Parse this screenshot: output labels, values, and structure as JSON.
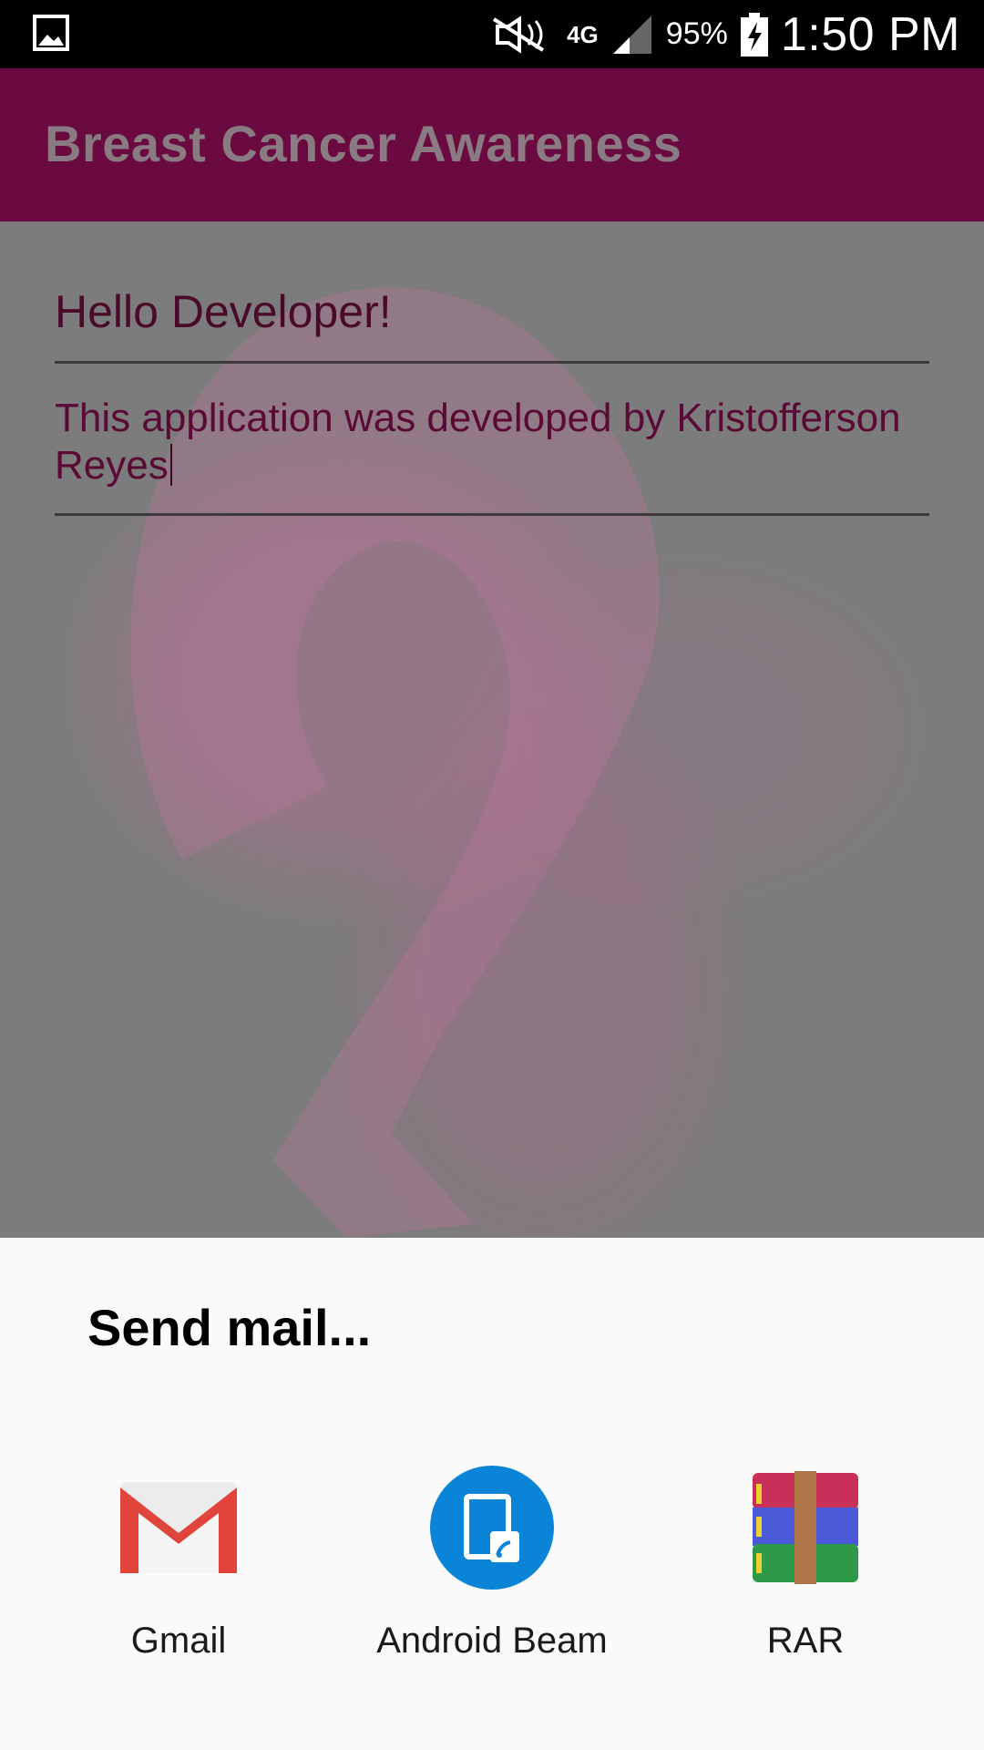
{
  "status_bar": {
    "network": "4G",
    "battery": "95%",
    "time": "1:50 PM"
  },
  "app_bar": {
    "title": "Breast Cancer Awareness"
  },
  "form": {
    "subject": "Hello Developer!",
    "body": "This application was developed by Kristofferson Reyes"
  },
  "share_sheet": {
    "title": "Send mail...",
    "apps": [
      {
        "label": "Gmail",
        "icon": "gmail-icon"
      },
      {
        "label": "Android Beam",
        "icon": "android-beam-icon"
      },
      {
        "label": "RAR",
        "icon": "rar-icon"
      }
    ]
  },
  "colors": {
    "app_bar": "#6a0a40",
    "beam_blue": "#0a84d6",
    "gmail_red": "#e0443a"
  }
}
